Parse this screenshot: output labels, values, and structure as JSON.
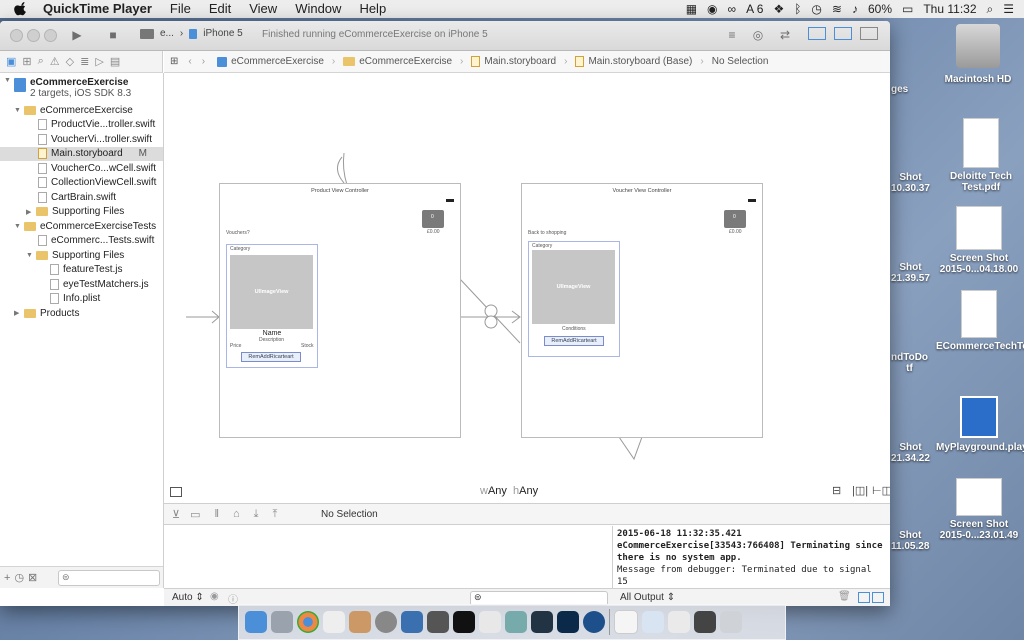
{
  "menubar": {
    "app_name": "QuickTime Player",
    "menus": [
      "File",
      "Edit",
      "View",
      "Window",
      "Help"
    ],
    "status_badge_count": "6",
    "battery": "60%",
    "clock": "Thu 11:32"
  },
  "toolbar": {
    "scheme_short": "e...",
    "device": "iPhone 5",
    "status_text": "Finished running eCommerceExercise on iPhone 5"
  },
  "jumpbar": {
    "segments": [
      "eCommerceExercise",
      "eCommerceExercise",
      "Main.storyboard",
      "Main.storyboard (Base)",
      "No Selection"
    ]
  },
  "navigator": {
    "project_name": "eCommerceExercise",
    "project_subtitle": "2 targets, iOS SDK 8.3",
    "items": [
      {
        "label": "eCommerceExercise",
        "type": "group"
      },
      {
        "label": "ProductVie...troller.swift",
        "type": "file"
      },
      {
        "label": "VoucherVi...troller.swift",
        "type": "file"
      },
      {
        "label": "Main.storyboard",
        "type": "storyboard",
        "badge": "M",
        "selected": true
      },
      {
        "label": "VoucherCo...wCell.swift",
        "type": "file"
      },
      {
        "label": "CollectionViewCell.swift",
        "type": "file"
      },
      {
        "label": "CartBrain.swift",
        "type": "file"
      },
      {
        "label": "Supporting Files",
        "type": "group"
      },
      {
        "label": "eCommerceExerciseTests",
        "type": "group"
      },
      {
        "label": "eCommerc...Tests.swift",
        "type": "file"
      },
      {
        "label": "Supporting Files",
        "type": "group"
      },
      {
        "label": "featureTest.js",
        "type": "file"
      },
      {
        "label": "eyeTestMatchers.js",
        "type": "file"
      },
      {
        "label": "Info.plist",
        "type": "file"
      },
      {
        "label": "Products",
        "type": "group"
      }
    ]
  },
  "storyboard": {
    "product_scene": {
      "title": "Product View Controller",
      "bag_count": "0",
      "bag_price": "£0.00",
      "prompt": "Vouchers?",
      "cell_category": "Category",
      "image_label": "UIImageView",
      "name_label": "Name",
      "description_label": "Description",
      "price_label": "Price",
      "stock_label": "Stock",
      "button_label": "RemAddRicarteart"
    },
    "voucher_scene": {
      "title": "Voucher View Controller",
      "bag_count": "0",
      "bag_price": "£0.00",
      "prompt": "Back to shopping",
      "cell_category": "Category",
      "image_label": "UIImageView",
      "condition_label": "Conditions",
      "button_label": "RemAddRicarteart"
    }
  },
  "size_class": {
    "w_prefix": "w",
    "w_value": "Any",
    "h_prefix": "h",
    "h_value": "Any"
  },
  "debug": {
    "selection": "No Selection",
    "console_lines": [
      {
        "text": "2015-06-18 11:32:35.421",
        "bold": true
      },
      {
        "text": "eCommerceExercise[33543:766408] Terminating since",
        "bold": true
      },
      {
        "text": "there is no system app.",
        "bold": true
      },
      {
        "text": "Message from debugger: Terminated due to signal 15",
        "bold": false
      }
    ],
    "variables_scope": "Auto",
    "output_filter": "All Output"
  },
  "desktop_icons": [
    {
      "label": "Macintosh HD"
    },
    {
      "label": "Deloitte Tech Test.pdf"
    },
    {
      "label": "Screen Shot 2015-0...04.18.00"
    },
    {
      "label": "ECommerceTechTest.rtf"
    },
    {
      "label": "MyPlayground.playground"
    },
    {
      "label": "Screen Shot 2015-0...23.01.49"
    }
  ],
  "desktop_partial_labels": [
    "ges",
    "Shot",
    "10.30.37",
    "Shot",
    "21.39.57",
    "ndToDo",
    "tf",
    "Shot",
    "21.34.22",
    "Shot",
    "11.05.28"
  ],
  "colors": {
    "accent": "#4a8fd8",
    "folder": "#e9c46a",
    "selection": "#dcdcdc"
  }
}
